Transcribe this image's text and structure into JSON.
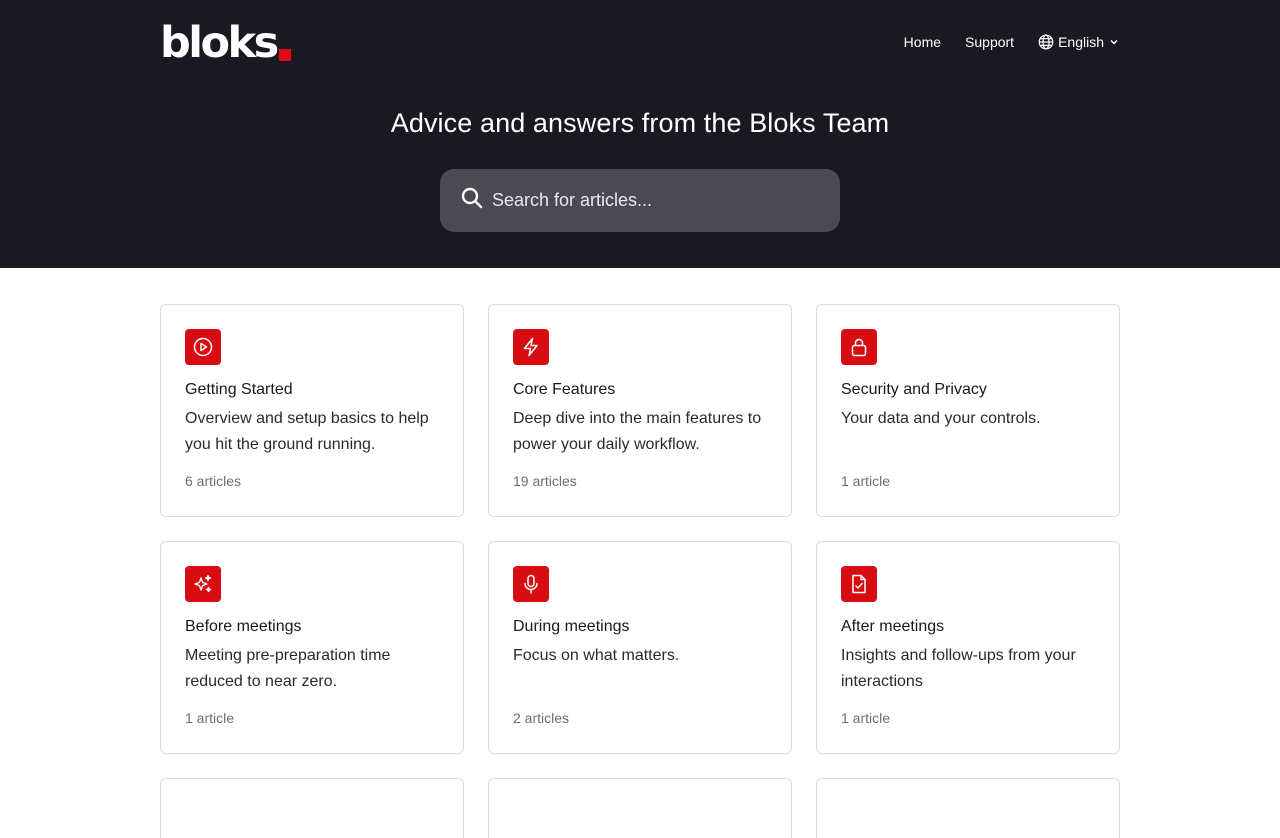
{
  "brand": {
    "logo_text": "bloks",
    "accent_color": "#e30613"
  },
  "nav": {
    "home": "Home",
    "support": "Support",
    "language": {
      "label": "English",
      "icon": "globe-icon"
    }
  },
  "hero": {
    "title": "Advice and answers from the Bloks Team",
    "search": {
      "placeholder": "Search for articles...",
      "icon": "search-icon"
    }
  },
  "collections": [
    {
      "icon": "play-circle-icon",
      "title": "Getting Started",
      "description": "Overview and setup basics to help you hit the ground running.",
      "count": "6 articles"
    },
    {
      "icon": "lightning-icon",
      "title": "Core Features",
      "description": "Deep dive into the main features to power your daily workflow.",
      "count": "19 articles"
    },
    {
      "icon": "lock-icon",
      "title": "Security and Privacy",
      "description": "Your data and your controls.",
      "count": "1 article"
    },
    {
      "icon": "sparkles-icon",
      "title": "Before meetings",
      "description": "Meeting pre-preparation time reduced to near zero.",
      "count": "1 article"
    },
    {
      "icon": "microphone-icon",
      "title": "During meetings",
      "description": "Focus on what matters.",
      "count": "2 articles"
    },
    {
      "icon": "document-check-icon",
      "title": "After meetings",
      "description": "Insights and follow-ups from your interactions",
      "count": "1 article"
    }
  ],
  "colors": {
    "hero_bg": "#1a1820",
    "search_bg": "#4b4a52",
    "icon_bg": "#d80d12"
  }
}
